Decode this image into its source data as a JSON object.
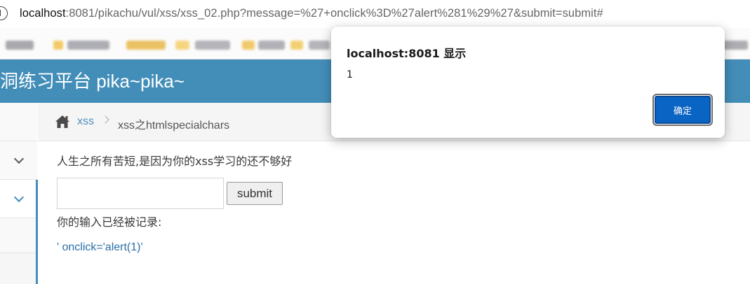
{
  "browser": {
    "url_host": "localhost",
    "url_rest": ":8081/pikachu/vul/xss/xss_02.php?message=%27+onclick%3D%27alert%281%29%27&submit=submit#",
    "info_icon": "info-circle-icon"
  },
  "header": {
    "title": "洞练习平台 pika~pika~",
    "background": "#438eb9"
  },
  "breadcrumb": {
    "home_icon": "home-icon",
    "link": "xss",
    "current": "xss之htmlspecialchars"
  },
  "main": {
    "intro": "人生之所有苦短,是因为你的xss学习的还不够好",
    "input_value": "",
    "submit_label": "submit",
    "record_label": "你的输入已经被记录:",
    "record_value": "' onclick='alert(1)'"
  },
  "dialog": {
    "title": "localhost:8081 显示",
    "message": "1",
    "ok_label": "确定",
    "ok_color": "#0a64c4"
  }
}
